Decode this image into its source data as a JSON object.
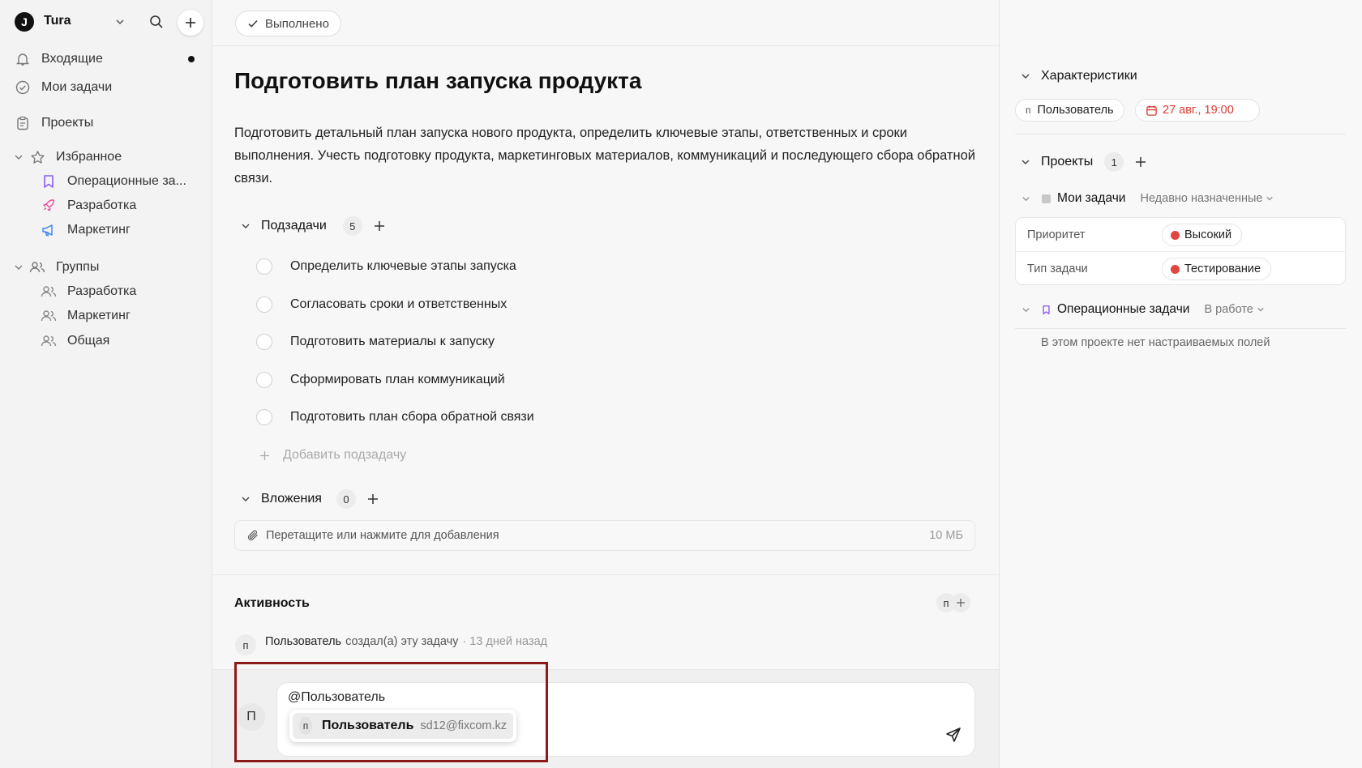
{
  "sidebar": {
    "logo_letter": "J",
    "workspace": "Tura",
    "items": {
      "inbox": "Входящие",
      "my_tasks": "Мои задачи",
      "projects": "Проекты"
    },
    "favorites": {
      "label": "Избранное",
      "items": [
        "Операционные за...",
        "Разработка",
        "Маркетинг"
      ]
    },
    "groups": {
      "label": "Группы",
      "items": [
        "Разработка",
        "Маркетинг",
        "Общая"
      ]
    }
  },
  "task": {
    "status": "Выполнено",
    "title": "Подготовить план запуска продукта",
    "description": "Подготовить детальный план запуска нового продукта, определить ключевые этапы, ответственных и сроки выполнения. Учесть подготовку продукта, маркетинговых материалов, коммуникаций и последующего сбора обратной связи."
  },
  "subtasks": {
    "label": "Подзадачи",
    "count": "5",
    "items": [
      "Определить ключевые этапы запуска",
      "Согласовать сроки и ответственных",
      "Подготовить материалы к запуску",
      "Сформировать план коммуникаций",
      "Подготовить план сбора обратной связи"
    ],
    "add_placeholder": "Добавить подзадачу"
  },
  "attachments": {
    "label": "Вложения",
    "count": "0",
    "drop_text": "Перетащите или нажмите для добавления",
    "limit": "10 МБ"
  },
  "activity": {
    "label": "Активность",
    "avatar": "п",
    "entry": {
      "avatar": "п",
      "user": "Пользователь",
      "action": "создал(а) эту задачу",
      "time": "· 13 дней назад"
    }
  },
  "comment": {
    "avatar": "П",
    "text": "@Пользователь",
    "mention": {
      "avatar": "п",
      "name": "Пользователь",
      "email": "sd12@fixcom.kz"
    }
  },
  "details": {
    "label": "Характеристики",
    "assignee_avatar": "п",
    "assignee": "Пользователь",
    "due": "27 авг., 19:00",
    "due_color": "#d93b32"
  },
  "projects": {
    "label": "Проекты",
    "count": "1",
    "my_tasks": {
      "name": "Мои задачи",
      "section": "Недавно назначенные",
      "fields": [
        {
          "label": "Приоритет",
          "value": "Высокий"
        },
        {
          "label": "Тип задачи",
          "value": "Тестирование"
        }
      ]
    },
    "ops": {
      "name": "Операционные задачи",
      "section": "В работе",
      "empty": "В этом проекте нет настраиваемых полей"
    }
  },
  "colors": {
    "accent_purple": "#8b5cf6",
    "accent_pink": "#ec4899",
    "accent_blue": "#3b82f6",
    "highlight": "#8b1a1a",
    "tag_red": "#e0463e"
  }
}
